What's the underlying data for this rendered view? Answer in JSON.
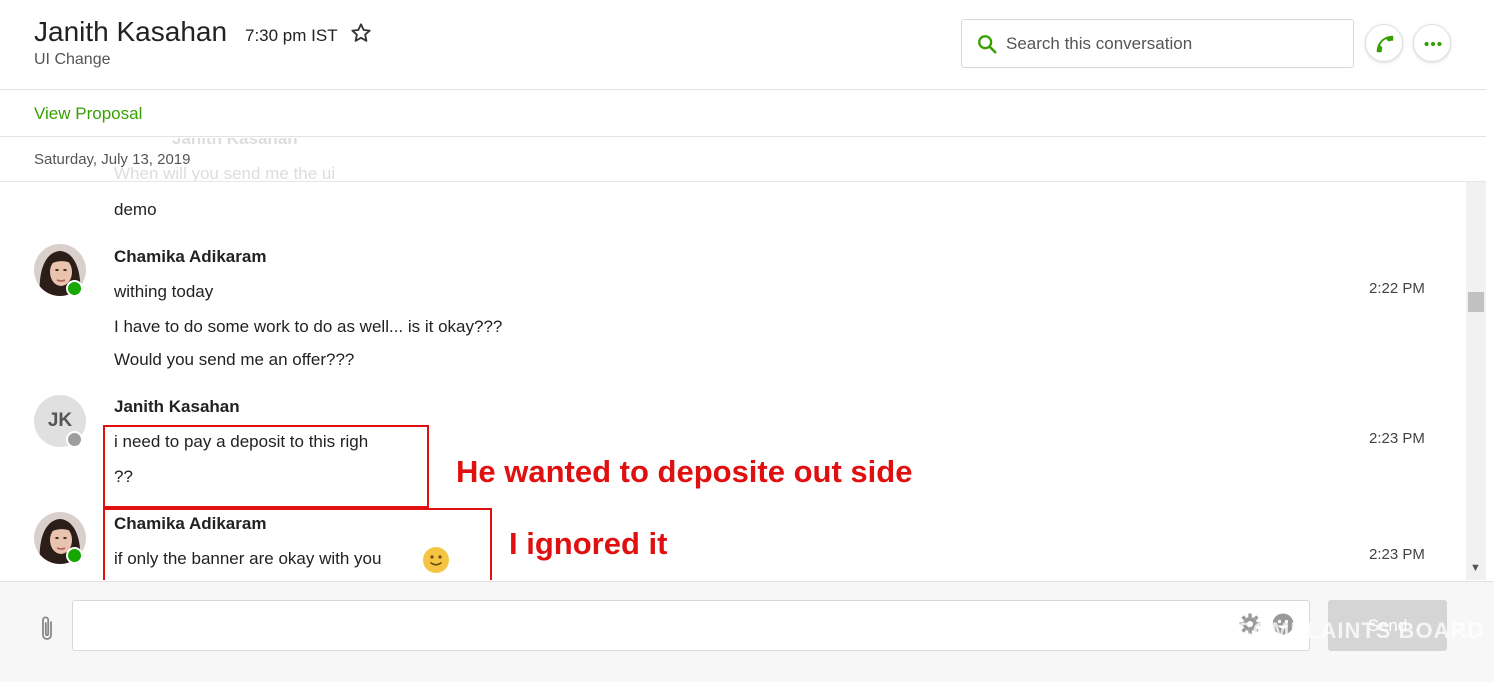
{
  "header": {
    "contact_name": "Janith Kasahan",
    "local_time": "7:30 pm IST",
    "subtitle": "UI Change",
    "search_placeholder": "Search this conversation"
  },
  "proposal": {
    "link_label": "View Proposal"
  },
  "date_divider": {
    "label": "Saturday, July 13, 2019",
    "ghost_sender": "Janith Kasahan",
    "ghost_text": "When will you send me the ui"
  },
  "messages": [
    {
      "text": "demo"
    },
    {
      "sender": "Chamika Adikaram",
      "status": "online",
      "time": "2:22 PM",
      "lines": [
        "withing today",
        "I have to do some work to do as well... is it okay???",
        "Would you send me an offer???"
      ]
    },
    {
      "sender": "Janith Kasahan",
      "initials": "JK",
      "status": "offline",
      "time": "2:23 PM",
      "lines": [
        "i need to pay a deposit to this righ",
        "??"
      ]
    },
    {
      "sender": "Chamika Adikaram",
      "status": "online",
      "time": "2:23 PM",
      "lines": [
        "if only the banner are okay with you"
      ],
      "emoji": "slightly-smiling-face"
    }
  ],
  "annotations": [
    {
      "text": "He wanted to deposite out side"
    },
    {
      "text": "I ignored it"
    }
  ],
  "composer": {
    "send_label": "Send",
    "watermark": "COMPLAINTS BOARD"
  },
  "colors": {
    "accent_green": "#37a000",
    "online_green": "#14a800",
    "annotation_red": "#e01010"
  },
  "icons": [
    "star-icon",
    "search-icon",
    "phone-icon",
    "more-icon",
    "attach-icon",
    "settings-icon",
    "emoji-picker-icon"
  ]
}
